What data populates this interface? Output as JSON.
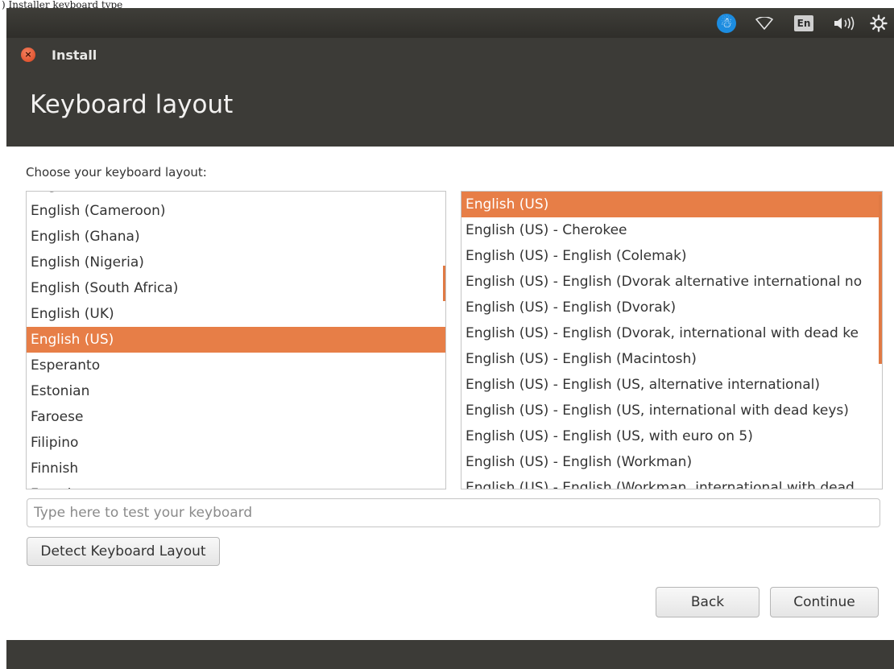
{
  "caption": ") Installer keyboard type",
  "system_tray": {
    "accessibility_icon": "accessibility-icon",
    "network_icon": "wifi-icon",
    "language_label": "En",
    "sound_icon": "sound-icon",
    "power_icon": "gear-icon"
  },
  "window": {
    "title": "Install"
  },
  "header": {
    "title": "Keyboard layout"
  },
  "layout_label": "Choose your keyboard layout:",
  "languages": [
    {
      "label": "English (Cameroon)"
    },
    {
      "label": "English (Ghana)"
    },
    {
      "label": "English (Nigeria)"
    },
    {
      "label": "English (South Africa)"
    },
    {
      "label": "English (UK)"
    },
    {
      "label": "English (US)",
      "selected": true
    },
    {
      "label": "Esperanto"
    },
    {
      "label": "Estonian"
    },
    {
      "label": "Faroese"
    },
    {
      "label": "Filipino"
    },
    {
      "label": "Finnish"
    }
  ],
  "variants": [
    {
      "label": "English (US)",
      "selected": true
    },
    {
      "label": "English (US) - Cherokee"
    },
    {
      "label": "English (US) - English (Colemak)"
    },
    {
      "label": "English (US) - English (Dvorak alternative international no"
    },
    {
      "label": "English (US) - English (Dvorak)"
    },
    {
      "label": "English (US) - English (Dvorak, international with dead ke"
    },
    {
      "label": "English (US) - English (Macintosh)"
    },
    {
      "label": "English (US) - English (US, alternative international)"
    },
    {
      "label": "English (US) - English (US, international with dead keys)"
    },
    {
      "label": "English (US) - English (US, with euro on 5)"
    },
    {
      "label": "English (US) - English (Workman)"
    },
    {
      "label": "English (US) - English (Workman, international with dead"
    }
  ],
  "test_input": {
    "placeholder": "Type here to test your keyboard",
    "value": ""
  },
  "buttons": {
    "detect": "Detect Keyboard Layout",
    "back": "Back",
    "continue": "Continue"
  },
  "colors": {
    "accent": "#e77e47",
    "chrome": "#3c3b37"
  }
}
